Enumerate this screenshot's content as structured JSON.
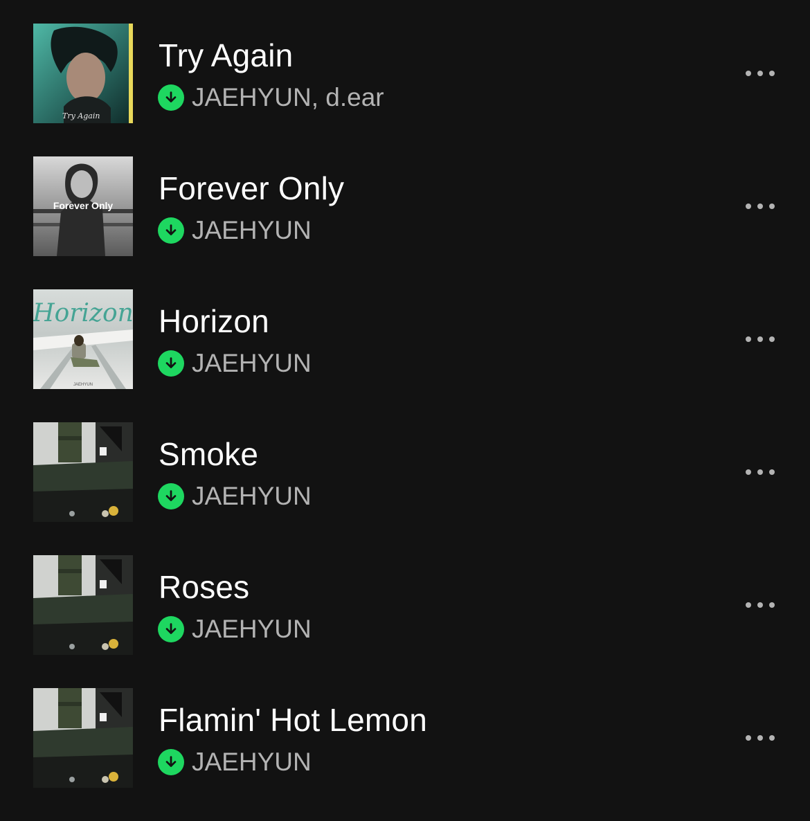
{
  "colors": {
    "background": "#121212",
    "title": "#ffffff",
    "artist": "#b3b3b3",
    "download_badge": "#1ed760"
  },
  "tracks": [
    {
      "title": "Try Again",
      "artist": "JAEHYUN, d.ear",
      "downloaded": true,
      "more_icon": "more-horizontal-icon"
    },
    {
      "title": "Forever Only",
      "artist": "JAEHYUN",
      "downloaded": true,
      "more_icon": "more-horizontal-icon"
    },
    {
      "title": "Horizon",
      "artist": "JAEHYUN",
      "downloaded": true,
      "more_icon": "more-horizontal-icon"
    },
    {
      "title": "Smoke",
      "artist": "JAEHYUN",
      "downloaded": true,
      "more_icon": "more-horizontal-icon"
    },
    {
      "title": "Roses",
      "artist": "JAEHYUN",
      "downloaded": true,
      "more_icon": "more-horizontal-icon"
    },
    {
      "title": "Flamin' Hot Lemon",
      "artist": "JAEHYUN",
      "downloaded": true,
      "more_icon": "more-horizontal-icon"
    }
  ],
  "covers": {
    "try_again_text": "Try Again",
    "forever_only_text": "Forever Only",
    "horizon_text": "Horizon",
    "horizon_artist_text": "JAEHYUN"
  }
}
